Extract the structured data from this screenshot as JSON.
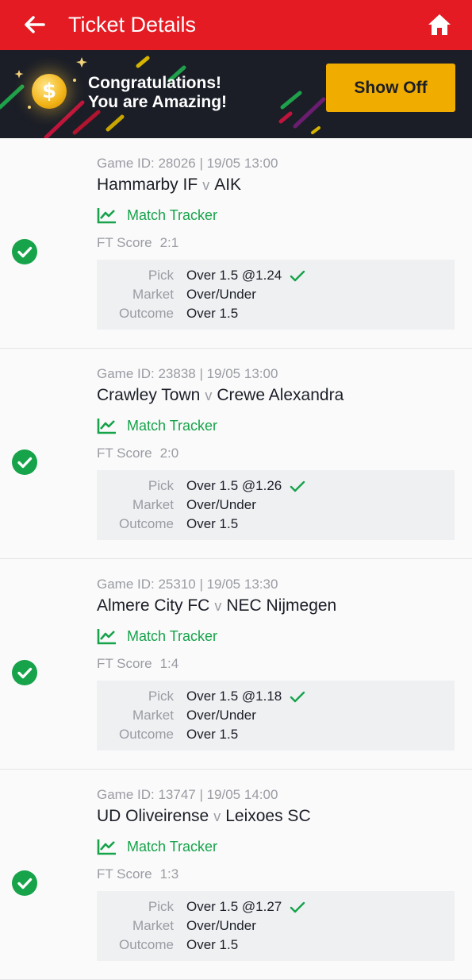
{
  "header": {
    "title": "Ticket Details",
    "bg_color": "#e41b23",
    "back_icon": "arrow-left-icon",
    "home_icon": "home-icon"
  },
  "banner": {
    "line1": "Congratulations!",
    "line2": "You are Amazing!",
    "button_label": "Show Off",
    "button_color": "#f1ac00",
    "coin_symbol": "$"
  },
  "labels": {
    "match_tracker": "Match Tracker",
    "ft_score": "FT Score",
    "pick": "Pick",
    "market": "Market",
    "outcome": "Outcome",
    "versus": "v"
  },
  "colors": {
    "win_green": "#16a34a",
    "muted": "#9a9ca3",
    "text": "#1b1e27"
  },
  "games": [
    {
      "game_info": "Game ID: 28026 | 19/05 13:00",
      "home": "Hammarby IF",
      "away": "AIK",
      "ft_score": "2:1",
      "pick": "Over 1.5 @1.24",
      "market": "Over/Under",
      "outcome": "Over 1.5",
      "status": "won"
    },
    {
      "game_info": "Game ID: 23838 | 19/05 13:00",
      "home": "Crawley Town",
      "away": "Crewe Alexandra",
      "ft_score": "2:0",
      "pick": "Over 1.5 @1.26",
      "market": "Over/Under",
      "outcome": "Over 1.5",
      "status": "won"
    },
    {
      "game_info": "Game ID: 25310 | 19/05 13:30",
      "home": "Almere City FC",
      "away": "NEC Nijmegen",
      "ft_score": "1:4",
      "pick": "Over 1.5 @1.18",
      "market": "Over/Under",
      "outcome": "Over 1.5",
      "status": "won"
    },
    {
      "game_info": "Game ID: 13747 | 19/05 14:00",
      "home": "UD Oliveirense",
      "away": "Leixoes SC",
      "ft_score": "1:3",
      "pick": "Over 1.5 @1.27",
      "market": "Over/Under",
      "outcome": "Over 1.5",
      "status": "won"
    }
  ]
}
